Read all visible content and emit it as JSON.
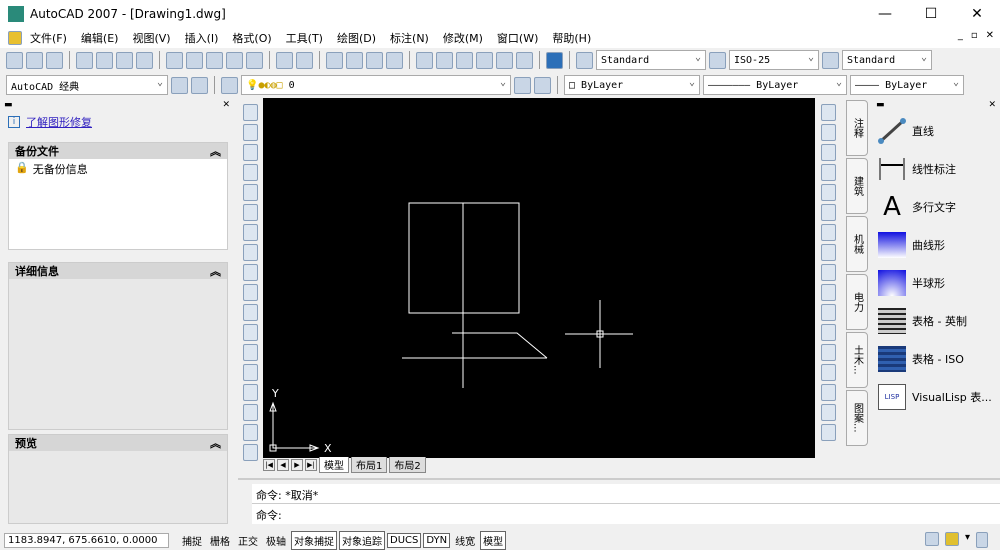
{
  "window": {
    "title": "AutoCAD 2007 - [Drawing1.dwg]",
    "min": "—",
    "max": "☐",
    "close": "✕"
  },
  "menu": [
    "文件(F)",
    "编辑(E)",
    "视图(V)",
    "插入(I)",
    "格式(O)",
    "工具(T)",
    "绘图(D)",
    "标注(N)",
    "修改(M)",
    "窗口(W)",
    "帮助(H)"
  ],
  "mdi": {
    "min": "_",
    "restore": "▫",
    "close": "✕"
  },
  "styles": {
    "text_style": "Standard",
    "dim_style": "ISO-25",
    "table_style": "Standard"
  },
  "workspace": "AutoCAD 经典",
  "layer": "0",
  "properties": {
    "color": "ByLayer",
    "linetype": "ByLayer",
    "lineweight": "ByLayer"
  },
  "left_panel": {
    "link": "了解图形修复",
    "backup_title": "备份文件",
    "backup_item": "无备份信息",
    "details_title": "详细信息",
    "preview_title": "预览"
  },
  "layout_tabs": [
    "模型",
    "布局1",
    "布局2"
  ],
  "ucs": {
    "x": "X",
    "y": "Y"
  },
  "command": {
    "history": "命令: *取消*",
    "prompt": "命令:"
  },
  "palette_tabs": [
    "注释",
    "建筑",
    "机械",
    "电力",
    "土木...",
    "图案..."
  ],
  "palette_items": [
    {
      "label": "直线",
      "icon": "line-icon"
    },
    {
      "label": "线性标注",
      "icon": "linear-dimension-icon"
    },
    {
      "label": "多行文字",
      "icon": "mtext-icon"
    },
    {
      "label": "曲线形",
      "icon": "gradient-icon"
    },
    {
      "label": "半球形",
      "icon": "gradient-icon"
    },
    {
      "label": "表格 - 英制",
      "icon": "table-icon"
    },
    {
      "label": "表格 - ISO",
      "icon": "table-icon"
    },
    {
      "label": "VisualLisp 表...",
      "icon": "lisp-icon"
    }
  ],
  "status": {
    "coords": "1183.8947, 675.6610, 0.0000",
    "buttons": [
      {
        "label": "捕捉",
        "on": false
      },
      {
        "label": "栅格",
        "on": false
      },
      {
        "label": "正交",
        "on": false
      },
      {
        "label": "极轴",
        "on": false
      },
      {
        "label": "对象捕捉",
        "on": true
      },
      {
        "label": "对象追踪",
        "on": true
      },
      {
        "label": "DUCS",
        "on": true
      },
      {
        "label": "DYN",
        "on": true
      },
      {
        "label": "线宽",
        "on": false
      },
      {
        "label": "模型",
        "on": true
      }
    ]
  }
}
